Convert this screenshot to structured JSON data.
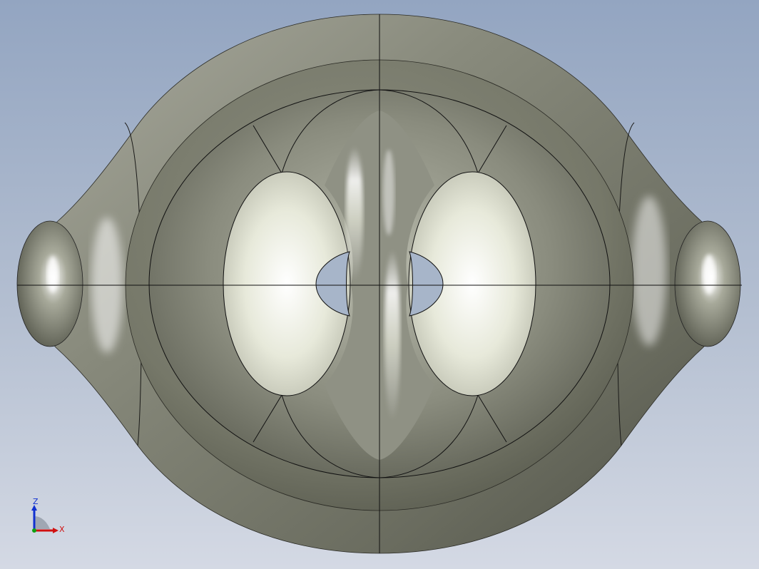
{
  "viewer": {
    "background_top": "#93a5c1",
    "background_bottom": "#d4d9e4",
    "model": {
      "surface_color": "#7d7f71",
      "highlight_color": "#f4f6e8",
      "edge_color": "#111111",
      "hole_color": "#a7b5c9"
    }
  },
  "triad": {
    "z_label": "Z",
    "x_label": "X",
    "z_color": "#1030d0",
    "x_color": "#d01010",
    "y_color": "#10a010"
  }
}
